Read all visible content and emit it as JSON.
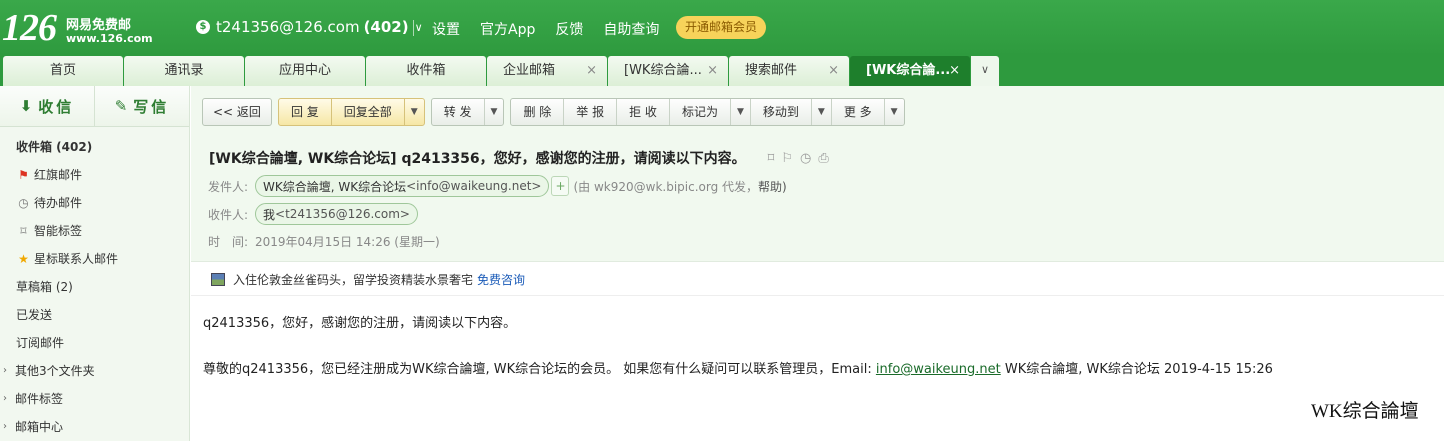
{
  "header": {
    "logo_number": "126",
    "logo_name": "网易免费邮",
    "logo_domain": "www.126.com",
    "account_email": "t241356@126.com",
    "account_count": "(402)",
    "links": [
      "设置",
      "官方App",
      "反馈",
      "自助查询"
    ],
    "vip_button": "开通邮箱会员"
  },
  "tabs": [
    {
      "label": "首页",
      "closable": false,
      "active": false
    },
    {
      "label": "通讯录",
      "closable": false,
      "active": false
    },
    {
      "label": "应用中心",
      "closable": false,
      "active": false
    },
    {
      "label": "收件箱",
      "closable": false,
      "active": false
    },
    {
      "label": "企业邮箱",
      "closable": true,
      "active": false
    },
    {
      "label": "[WK综合論...",
      "closable": true,
      "active": false
    },
    {
      "label": "搜索邮件",
      "closable": true,
      "active": false
    },
    {
      "label": "[WK综合論...",
      "closable": true,
      "active": true
    }
  ],
  "tab_close_glyph": "×",
  "sidebar": {
    "receive": "收信",
    "write": "写信",
    "items": [
      {
        "label": "收件箱 (402)",
        "icon": "",
        "kind": "bold"
      },
      {
        "label": "红旗邮件",
        "icon": "flag-icon",
        "kind": "icon"
      },
      {
        "label": "待办邮件",
        "icon": "clock-icon",
        "kind": "icon"
      },
      {
        "label": "智能标签",
        "icon": "bookmark-icon",
        "kind": "icon"
      },
      {
        "label": "星标联系人邮件",
        "icon": "star-icon",
        "kind": "icon"
      },
      {
        "label": "草稿箱 (2)",
        "icon": "",
        "kind": "plain"
      },
      {
        "label": "已发送",
        "icon": "",
        "kind": "plain"
      },
      {
        "label": "订阅邮件",
        "icon": "",
        "kind": "plain"
      },
      {
        "label": "其他3个文件夹",
        "icon": "expand-icon",
        "kind": "expand"
      },
      {
        "label": "邮件标签",
        "icon": "expand-icon",
        "kind": "expand"
      },
      {
        "label": "邮箱中心",
        "icon": "expand-icon",
        "kind": "expand"
      }
    ]
  },
  "toolbar": {
    "back": "<< 返回",
    "reply": "回 复",
    "reply_all": "回复全部",
    "forward": "转 发",
    "delete": "删 除",
    "report": "举 报",
    "reject": "拒 收",
    "mark_as": "标记为",
    "move_to": "移动到",
    "more": "更 多"
  },
  "message": {
    "subject": "[WK综合論壇, WK综合论坛] q2413356，您好，感谢您的注册，请阅读以下内容。",
    "from_label": "发件人:",
    "from_name": "WK综合論壇, WK综合论坛",
    "from_addr": "<info@waikeung.net>",
    "via_text": "(由 wk920@wk.bipic.org 代发，",
    "via_help": "帮助)",
    "to_label": "收件人:",
    "to_name": "我",
    "to_addr": "<t241356@126.com>",
    "time_label": "时　间:",
    "time_value": "2019年04月15日 14:26 (星期一)"
  },
  "ad": {
    "text": "入住伦敦金丝雀码头，留学投资精装水景奢宅",
    "link": "免费咨询"
  },
  "body": {
    "line1": "q2413356，您好，感谢您的注册，请阅读以下内容。",
    "line2_prefix": "尊敬的q2413356，您已经注册成为WK综合論壇, WK综合论坛的会员。 如果您有什么疑问可以联系管理员，Email: ",
    "line2_link": "info@waikeung.net",
    "line2_suffix": " WK综合論壇, WK综合论坛 2019-4-15 15:26",
    "signature": "WK综合論壇"
  },
  "colors": {
    "brand_green": "#2e9a3e",
    "active_tab": "#1e7f2c",
    "vip_yellow": "#f7d35a"
  }
}
